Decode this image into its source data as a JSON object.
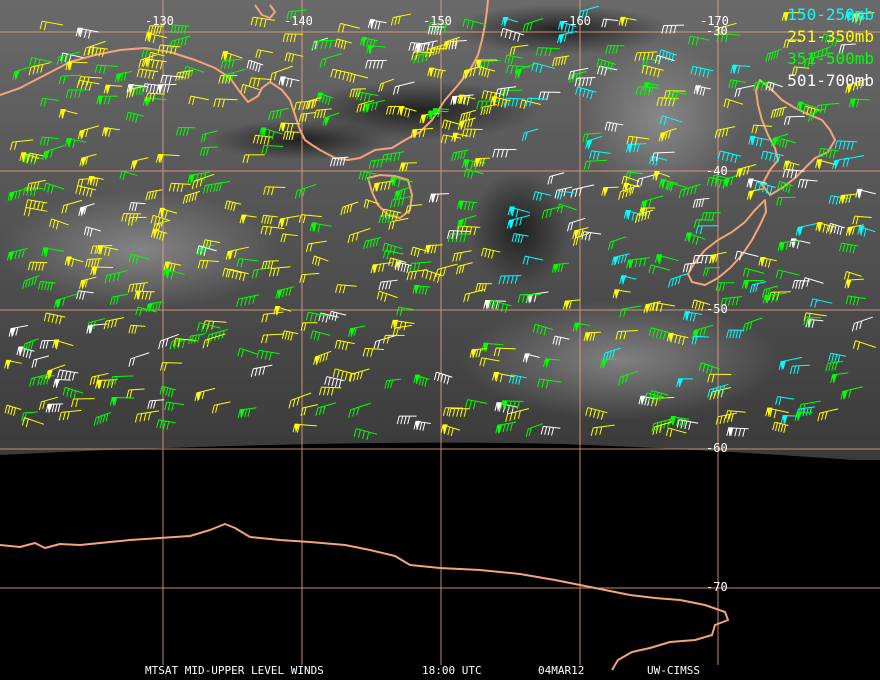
{
  "title": "MTSAT MID-UPPER LEVEL WINDS",
  "time": "18:00 UTC",
  "date": "04MAR12",
  "source": "UW-CIMSS",
  "legend": [
    {
      "label": "150-250mb",
      "color": "#00ffff"
    },
    {
      "label": "251-350mb",
      "color": "#ffff00"
    },
    {
      "label": "351-500mb",
      "color": "#00ff00"
    },
    {
      "label": "501-700mb",
      "color": "#ffffff"
    }
  ],
  "longitude_labels": [
    "-130",
    "-140",
    "-150",
    "-160",
    "-170"
  ],
  "latitude_labels": [
    "-30",
    "-40",
    "-50",
    "-60",
    "-70"
  ],
  "colors": {
    "coastline": "#f5a47a",
    "grid": "#e8a080",
    "background_cloud": "#5a5a5a",
    "night": "#000000"
  }
}
